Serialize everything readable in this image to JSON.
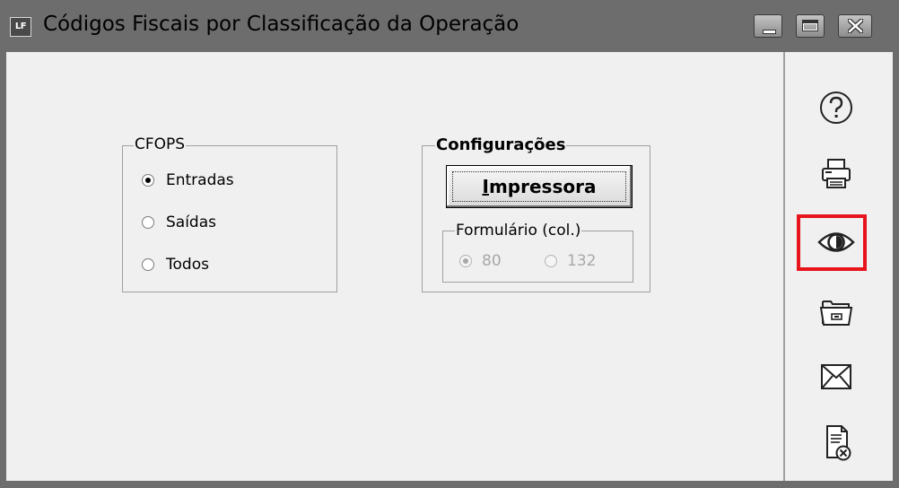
{
  "window": {
    "title": "Códigos Fiscais por Classificação da Operação",
    "app_icon_text": "LF"
  },
  "cfops": {
    "legend": "CFOPS",
    "options": [
      {
        "label": "Entradas",
        "checked": true
      },
      {
        "label": "Saídas",
        "checked": false
      },
      {
        "label": "Todos",
        "checked": false
      }
    ]
  },
  "config": {
    "legend": "Configurações",
    "printer_button": "Impressora",
    "form": {
      "legend": "Formulário (col.)",
      "options": [
        {
          "label": "80",
          "checked": true,
          "enabled": false
        },
        {
          "label": "132",
          "checked": false,
          "enabled": false
        }
      ]
    }
  },
  "toolbar": {
    "tools": [
      "help-icon",
      "print-icon",
      "preview-icon",
      "open-folder-icon",
      "email-icon",
      "close-document-icon"
    ],
    "highlighted": "preview-icon",
    "highlight_color": "#e8141c"
  }
}
